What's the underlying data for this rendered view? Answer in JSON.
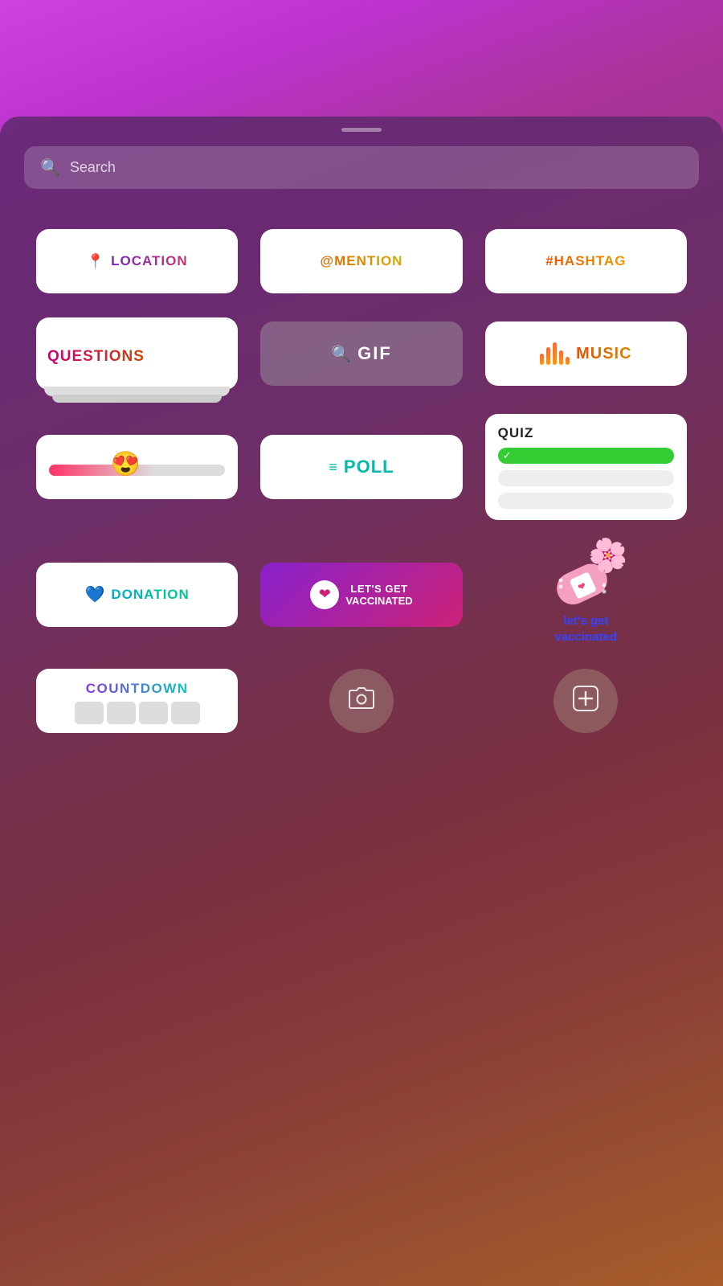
{
  "background": {
    "gradient_desc": "purple-to-orange gradient"
  },
  "search": {
    "placeholder": "Search",
    "icon": "search-icon"
  },
  "stickers": [
    {
      "id": "location",
      "label": "LOCATION",
      "icon": "📍",
      "type": "location"
    },
    {
      "id": "mention",
      "label": "@MENTION",
      "type": "mention"
    },
    {
      "id": "hashtag",
      "label": "#HASHTAG",
      "type": "hashtag"
    },
    {
      "id": "questions",
      "label": "QUESTIONS",
      "type": "questions"
    },
    {
      "id": "gif",
      "label": "GIF",
      "type": "gif"
    },
    {
      "id": "music",
      "label": "MUSIC",
      "type": "music"
    },
    {
      "id": "emoji-slider",
      "label": "",
      "type": "emoji-slider",
      "emoji": "😍"
    },
    {
      "id": "poll",
      "label": "POLL",
      "type": "poll"
    },
    {
      "id": "quiz",
      "label": "QUIZ",
      "type": "quiz"
    },
    {
      "id": "donation",
      "label": "DONATION",
      "type": "donation"
    },
    {
      "id": "vaccinated",
      "label": "LET'S GET VACCINATED",
      "label_top": "LET'S GET",
      "label_bottom": "VACCINATED",
      "type": "vaccinated"
    },
    {
      "id": "vaccinated-sticker",
      "label_line1": "let's get",
      "label_line2": "vaccinated",
      "type": "vaccinated-sticker"
    },
    {
      "id": "countdown",
      "label": "COUNTDOWN",
      "type": "countdown"
    },
    {
      "id": "camera",
      "type": "camera-icon"
    },
    {
      "id": "add-media",
      "type": "add-icon"
    }
  ],
  "bottom_icons": [
    {
      "id": "camera-btn",
      "symbol": "⊙",
      "label": "camera"
    },
    {
      "id": "add-btn",
      "symbol": "⊞",
      "label": "add"
    }
  ]
}
